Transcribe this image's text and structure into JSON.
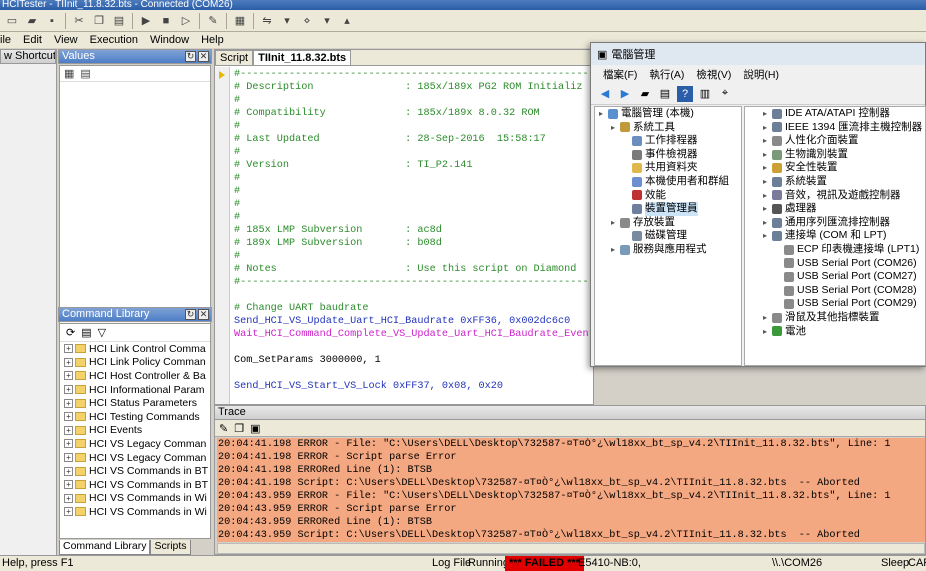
{
  "window": {
    "title": "HCITester - TIInit_11.8.32.bts - Connected (COM26)"
  },
  "menu": [
    "ile",
    "Edit",
    "View",
    "Execution",
    "Window",
    "Help"
  ],
  "shortcuts_panel": {
    "label": "w Shortcuts"
  },
  "values_panel": {
    "title": "Values"
  },
  "command_library": {
    "title": "Command Library",
    "items": [
      "HCI Link Control Comma",
      "HCI Link Policy Comman",
      "HCI Host Controller & Ba",
      "HCI Informational Param",
      "HCI Status Parameters",
      "HCI Testing Commands",
      "HCI Events",
      "HCI VS Legacy Comman",
      "HCI VS Legacy Comman",
      "HCI VS Commands in BT",
      "HCI VS Commands in BT",
      "HCI VS Commands in Wi",
      "HCI VS Commands in Wi"
    ],
    "tabs": [
      "Command Library",
      "Scripts"
    ]
  },
  "script": {
    "tabs": [
      "Script",
      "TIInit_11.8.32.bts"
    ],
    "lines": [
      {
        "t": "#------------------------------------------------------------------------",
        "c": "comment"
      },
      {
        "t": "# Description               : 185x/189x PG2 ROM Initializ",
        "c": "comment"
      },
      {
        "t": "#",
        "c": "comment"
      },
      {
        "t": "# Compatibility             : 185x/189x 8.0.32 ROM",
        "c": "comment"
      },
      {
        "t": "#",
        "c": "comment"
      },
      {
        "t": "# Last Updated              : 28-Sep-2016  15:58:17",
        "c": "comment"
      },
      {
        "t": "#",
        "c": "comment"
      },
      {
        "t": "# Version                   : TI_P2.141",
        "c": "comment"
      },
      {
        "t": "#",
        "c": "comment"
      },
      {
        "t": "#",
        "c": "comment"
      },
      {
        "t": "#",
        "c": "comment"
      },
      {
        "t": "#",
        "c": "comment"
      },
      {
        "t": "# 185x LMP Subversion       : ac8d",
        "c": "comment"
      },
      {
        "t": "# 189x LMP Subversion       : b08d",
        "c": "comment"
      },
      {
        "t": "#",
        "c": "comment"
      },
      {
        "t": "# Notes                     : Use this script on Diamond",
        "c": "comment"
      },
      {
        "t": "#------------------------------------------------------------------------",
        "c": "comment"
      },
      {
        "t": "",
        "c": "black"
      },
      {
        "t": "# Change UART baudrate",
        "c": "comment"
      },
      {
        "t": "Send_HCI_VS_Update_Uart_HCI_Baudrate 0xFF36, 0x002dc6c0",
        "c": "blue"
      },
      {
        "t": "Wait_HCI_Command_Complete_VS_Update_Uart_HCI_Baudrate_Event",
        "c": "mag"
      },
      {
        "t": "",
        "c": "black"
      },
      {
        "t": "Com_SetParams 3000000, 1",
        "c": "black"
      },
      {
        "t": "",
        "c": "black"
      },
      {
        "t": "Send_HCI_VS_Start_VS_Lock 0xFF37, 0x08, 0x20",
        "c": "blue"
      }
    ]
  },
  "trace": {
    "title": "Trace",
    "lines": [
      "20:04:41.198 ERROR - File: \"C:\\Users\\DELL\\Desktop\\732587-¤T¤Ò°¿\\wl18xx_bt_sp_v4.2\\TIInit_11.8.32.bts\", Line: 1",
      "20:04:41.198 ERROR - Script parse Error",
      "20:04:41.198 ERRORed Line (1): BTSB",
      "20:04:41.198 Script: C:\\Users\\DELL\\Desktop\\732587-¤T¤Ò°¿\\wl18xx_bt_sp_v4.2\\TIInit_11.8.32.bts  -- Aborted",
      "20:04:43.959 ERROR - File: \"C:\\Users\\DELL\\Desktop\\732587-¤T¤Ò°¿\\wl18xx_bt_sp_v4.2\\TIInit_11.8.32.bts\", Line: 1",
      "20:04:43.959 ERROR - Script parse Error",
      "20:04:43.959 ERRORed Line (1): BTSB",
      "20:04:43.959 Script: C:\\Users\\DELL\\Desktop\\732587-¤T¤Ò°¿\\wl18xx_bt_sp_v4.2\\TIInit_11.8.32.bts  -- Aborted"
    ]
  },
  "status": {
    "help": "Help, press F1",
    "log_file": "Log File",
    "running": "Running",
    "failed": "*** FAILED ***",
    "device": "E5410-NB:0,",
    "port": "\\\\.\\COM26",
    "sleep": "Sleep",
    "cap": "CAP"
  },
  "computer_management": {
    "title": "電腦管理",
    "menu": [
      "檔案(F)",
      "執行(A)",
      "檢視(V)",
      "說明(H)"
    ],
    "left_tree": [
      {
        "label": "電腦管理 (本機)",
        "level": 0,
        "color": "#5a8fd0"
      },
      {
        "label": "系統工具",
        "level": 1,
        "color": "#c09a3a"
      },
      {
        "label": "工作排程器",
        "level": 2,
        "color": "#6a8fbf"
      },
      {
        "label": "事件檢視器",
        "level": 2,
        "color": "#7a7a7a"
      },
      {
        "label": "共用資料夾",
        "level": 2,
        "color": "#e0b84a"
      },
      {
        "label": "本機使用者和群組",
        "level": 2,
        "color": "#6b8fcf"
      },
      {
        "label": "效能",
        "level": 2,
        "color": "#c03030"
      },
      {
        "label": "裝置管理員",
        "level": 2,
        "color": "#6f7f9f"
      },
      {
        "label": "存放裝置",
        "level": 1,
        "color": "#8a8a8a"
      },
      {
        "label": "磁碟管理",
        "level": 2,
        "color": "#7a8aa0"
      },
      {
        "label": "服務與應用程式",
        "level": 1,
        "color": "#7a9aba"
      }
    ],
    "right_tree": [
      {
        "label": "IDE ATA/ATAPI 控制器",
        "level": 0,
        "color": "#6b7f99"
      },
      {
        "label": "IEEE 1394 匯流排主機控制器",
        "level": 0,
        "color": "#6b7f99"
      },
      {
        "label": "人性化介面裝置",
        "level": 0,
        "color": "#8a8a8a"
      },
      {
        "label": "生物識別裝置",
        "level": 0,
        "color": "#7a9a7a"
      },
      {
        "label": "安全性裝置",
        "level": 0,
        "color": "#c9a233"
      },
      {
        "label": "系統裝置",
        "level": 0,
        "color": "#6b7f99"
      },
      {
        "label": "音效，視訊及遊戲控制器",
        "level": 0,
        "color": "#7a7a9a"
      },
      {
        "label": "處理器",
        "level": 0,
        "color": "#555555"
      },
      {
        "label": "通用序列匯流排控制器",
        "level": 0,
        "color": "#6b7f99"
      },
      {
        "label": "連接埠 (COM 和 LPT)",
        "level": 0,
        "color": "#6b7f99"
      },
      {
        "label": "ECP 印表機連接埠 (LPT1)",
        "level": 1,
        "color": "#8a8a8a"
      },
      {
        "label": "USB Serial Port (COM26)",
        "level": 1,
        "color": "#8a8a8a"
      },
      {
        "label": "USB Serial Port (COM27)",
        "level": 1,
        "color": "#8a8a8a"
      },
      {
        "label": "USB Serial Port (COM28)",
        "level": 1,
        "color": "#8a8a8a"
      },
      {
        "label": "USB Serial Port (COM29)",
        "level": 1,
        "color": "#8a8a8a"
      },
      {
        "label": "滑鼠及其他指標裝置",
        "level": 0,
        "color": "#8a8a8a"
      },
      {
        "label": "電池",
        "level": 0,
        "color": "#3a9a3a"
      }
    ]
  }
}
